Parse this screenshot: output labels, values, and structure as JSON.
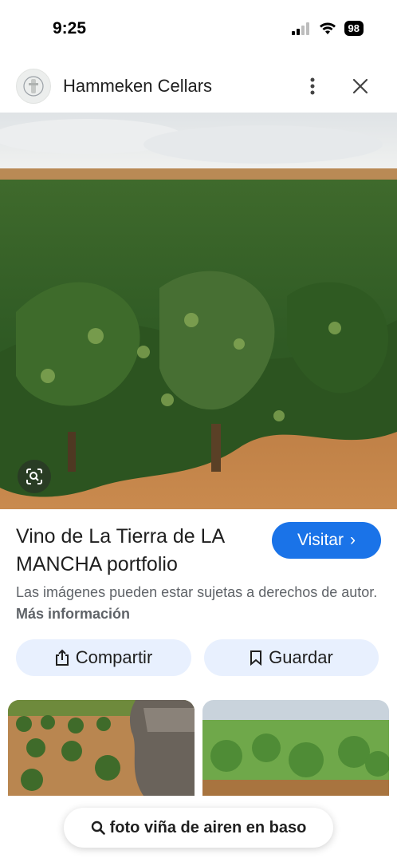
{
  "status_bar": {
    "time": "9:25",
    "battery": "98"
  },
  "header": {
    "site_name": "Hammeken Cellars",
    "more_icon": "more-vert-icon",
    "close_icon": "close-icon"
  },
  "image": {
    "title": "Vino de La Tierra de LA MANCHA portfolio"
  },
  "visit": {
    "label": "Visitar",
    "chevron": "›"
  },
  "copyright": {
    "text": "Las imágenes pueden estar sujetas a derechos de autor.",
    "more_info": "Más información"
  },
  "actions": {
    "share_label": "Compartir",
    "save_label": "Guardar"
  },
  "search": {
    "query": "foto viña de airen en baso"
  },
  "colors": {
    "accent": "#1a73e8",
    "chip_bg": "#e8f0fe",
    "muted_text": "#5f6368"
  }
}
